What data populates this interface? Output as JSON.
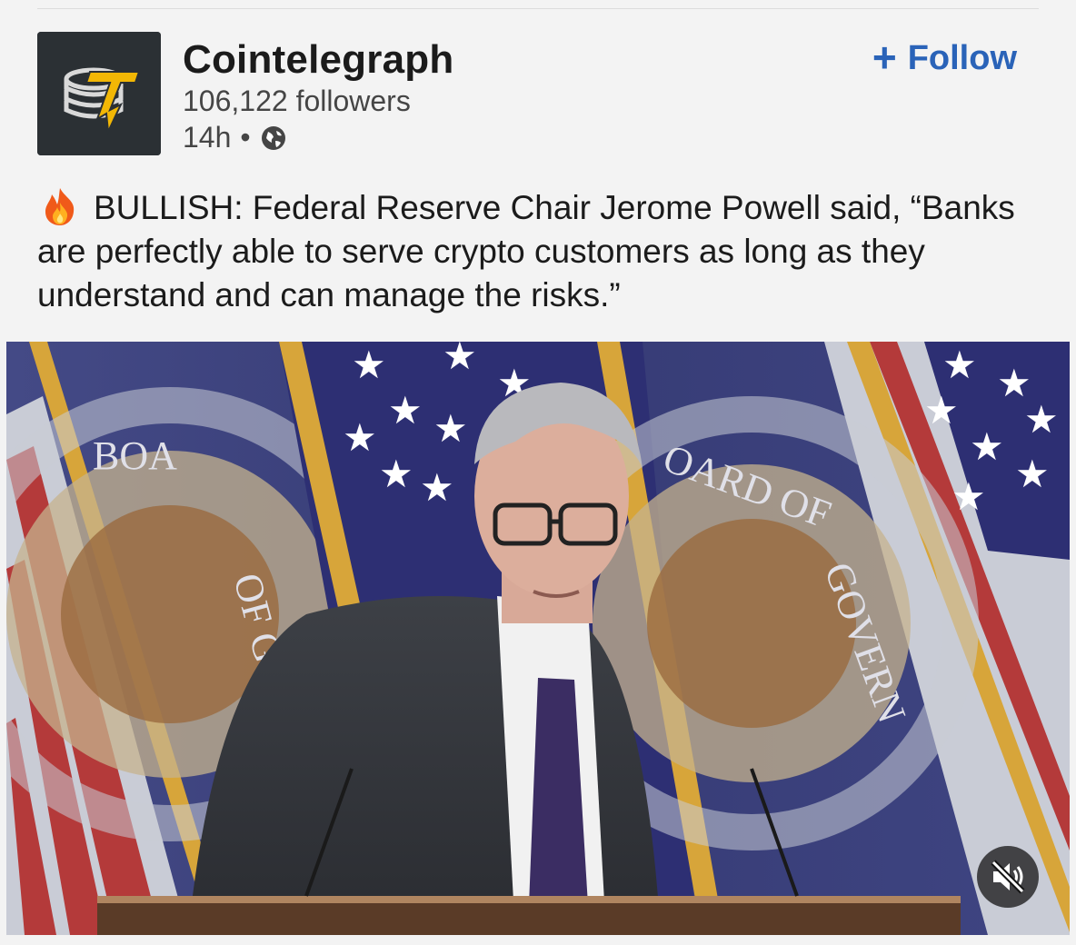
{
  "company": {
    "name": "Cointelegraph",
    "followers": "106,122 followers",
    "time": "14h",
    "separator": "•",
    "logo_bg": "#2b3034",
    "logo_accent": "#f2b705"
  },
  "follow_button": {
    "plus": "+",
    "label": "Follow",
    "color": "#2a63b8"
  },
  "post": {
    "emoji_icon": "fire-icon",
    "text": "BULLISH: Federal Reserve Chair Jerome Powell said, “Banks are perfectly able to serve crypto customers as long as they understand and can manage the risks.”"
  },
  "media": {
    "seal_left_text": "BOA OF GOVERNO",
    "seal_right_text": "OARD OF GOVERN",
    "mute_icon": "speaker-muted-icon",
    "flag_blue": "#2d2f73",
    "flag_red": "#b43a3a",
    "gold": "#d7a53a"
  }
}
